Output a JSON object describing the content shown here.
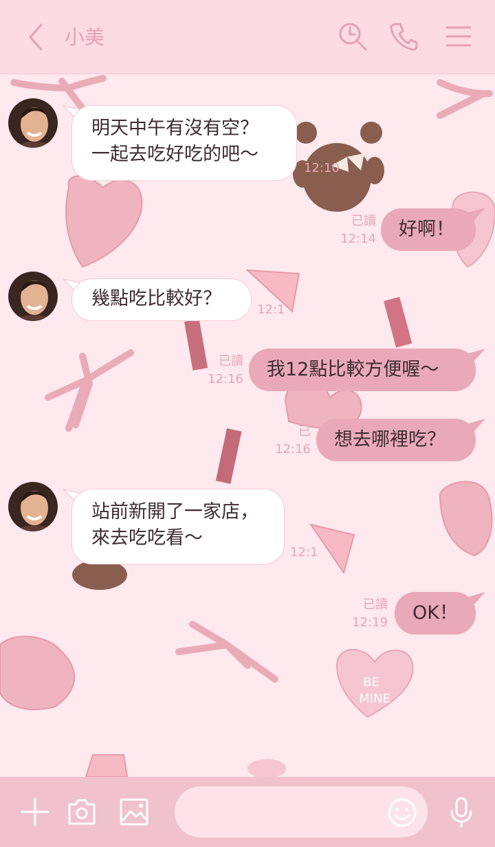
{
  "header": {
    "title": "小美",
    "icons": [
      "chevron-left-icon",
      "search-icon",
      "phone-icon",
      "menu-icon"
    ]
  },
  "messages": [
    {
      "side": "left",
      "text": "明天中午有沒有空？\n一起去吃好吃的吧～",
      "time": "12:10"
    },
    {
      "side": "right",
      "text": "好啊！",
      "read": "已讀",
      "time": "12:14"
    },
    {
      "side": "left",
      "text": "幾點吃比較好？",
      "time": "12:1"
    },
    {
      "side": "right",
      "text": "我12點比較方便喔～",
      "read": "已讀",
      "time": "12:16"
    },
    {
      "side": "right",
      "text": "想去哪裡吃？",
      "read": "已",
      "time": "12:16"
    },
    {
      "side": "left",
      "text": "站前新開了一家店，\n來去吃吃看～",
      "time": "12:1"
    },
    {
      "side": "right",
      "text": "OK！",
      "read": "已讀",
      "time": "12:19"
    }
  ],
  "footer": {
    "input_placeholder": "",
    "icons": [
      "plus-icon",
      "camera-icon",
      "image-icon",
      "emoji-icon",
      "microphone-icon"
    ]
  },
  "colors": {
    "header_bg": "#fddbe2",
    "chat_bg": "#fde9ee",
    "right_bubble": "#e9a9b9",
    "left_bubble": "#ffffff",
    "accent": "#e3a2b3",
    "footer_bg": "#f0c2ce"
  },
  "decor": {
    "sticker_text": [
      "BE",
      "MINE"
    ]
  }
}
